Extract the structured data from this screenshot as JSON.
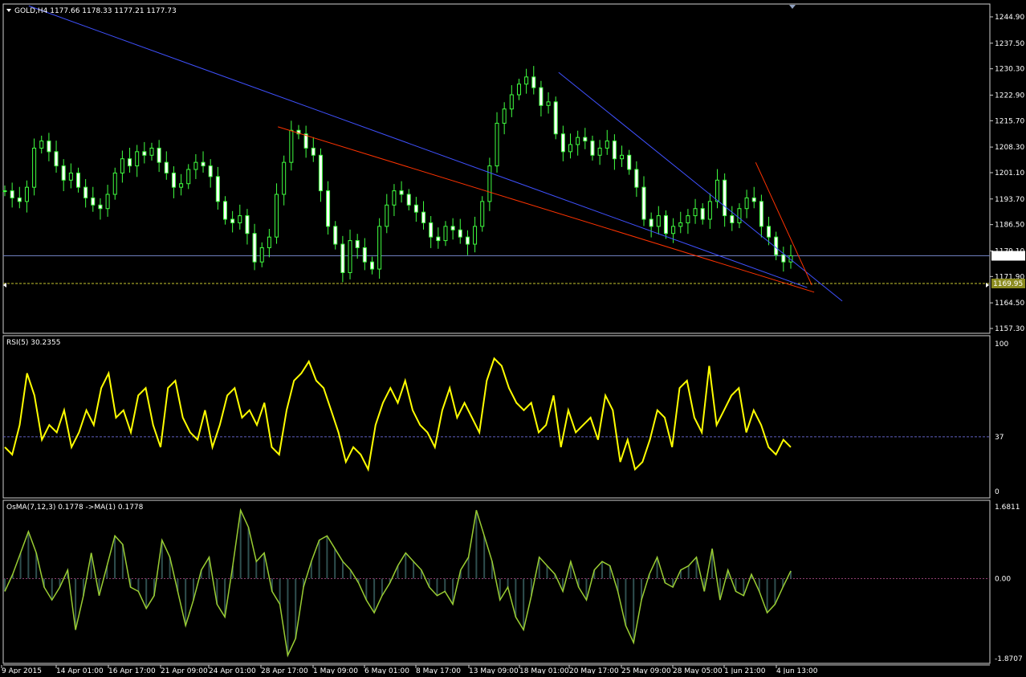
{
  "chart_data": [
    {
      "type": "candlestick",
      "title": "GOLD,H4",
      "ohlc_text": "1177.66 1178.33 1177.21 1177.73",
      "ylim": [
        1157.3,
        1244.9
      ],
      "price_ticks": [
        "1244.90",
        "1237.50",
        "1230.30",
        "1222.90",
        "1215.70",
        "1208.30",
        "1201.10",
        "1193.70",
        "1186.50",
        "1179.10",
        "1171.90",
        "1164.50",
        "1157.30"
      ],
      "current_price": "1177.73",
      "current_price_value": 1177.73,
      "level_line_label": "1169.95",
      "level_line_value": 1169.95,
      "close_values": [
        1196,
        1194,
        1193,
        1197,
        1208,
        1210,
        1207,
        1203,
        1199,
        1201,
        1197,
        1194,
        1192,
        1191,
        1195,
        1201,
        1205,
        1203,
        1207,
        1206,
        1208,
        1204,
        1201,
        1197,
        1198,
        1202,
        1204,
        1203,
        1200,
        1193,
        1188,
        1187,
        1189,
        1184,
        1176,
        1180,
        1183,
        1195,
        1204,
        1213,
        1212,
        1208,
        1206,
        1196,
        1186,
        1181,
        1173,
        1182,
        1180,
        1176,
        1174,
        1186,
        1192,
        1196,
        1195,
        1192,
        1190,
        1187,
        1183,
        1182,
        1186,
        1185,
        1183,
        1181,
        1186,
        1193,
        1203,
        1215,
        1219,
        1223,
        1226,
        1228,
        1225,
        1220,
        1221,
        1212,
        1207,
        1209,
        1211,
        1210,
        1206,
        1208,
        1210,
        1205,
        1206,
        1202,
        1197,
        1188,
        1186,
        1189,
        1184,
        1186,
        1187,
        1189,
        1191,
        1188,
        1193,
        1199,
        1189,
        1187,
        1191,
        1194,
        1193,
        1186,
        1183,
        1178,
        1176,
        1177.73
      ],
      "trendlines": [
        {
          "color": "#3f51ff",
          "from": [
            "11 Apr 2015 06:00",
            1248
          ],
          "to": [
            "5 Jun 2015 17:00",
            1168.8
          ]
        },
        {
          "color": "#3f51ff",
          "from": [
            "19 May 2015 00:00",
            1229.3
          ],
          "to": [
            "8 Jun 2015 05:00",
            1165
          ]
        },
        {
          "color": "#ff3300",
          "from": [
            "29 Apr 2015 00:00",
            1214
          ],
          "to": [
            "6 Jun 2015 05:00",
            1167.5
          ]
        },
        {
          "color": "#ff3300",
          "from": [
            "2 Jun 2015 01:00",
            1204
          ],
          "to": [
            "6 Jun 2015 01:00",
            1169.5
          ]
        }
      ],
      "x_labels": [
        "9 Apr 2015",
        "14 Apr 01:00",
        "16 Apr 17:00",
        "21 Apr 09:00",
        "24 Apr 01:00",
        "28 Apr 17:00",
        "1 May 09:00",
        "6 May 01:00",
        "8 May 17:00",
        "13 May 09:00",
        "18 May 01:00",
        "20 May 17:00",
        "25 May 09:00",
        "28 May 05:00",
        "1 Jun 21:00",
        "4 Jun 13:00"
      ]
    },
    {
      "type": "line",
      "title": "RSI(5) 30.2355",
      "ylim": [
        0,
        100
      ],
      "ticks": [
        "100",
        "37",
        "0"
      ],
      "level": 37,
      "color": "#ffff00",
      "values": [
        30,
        25,
        45,
        80,
        65,
        35,
        45,
        40,
        55,
        30,
        40,
        55,
        45,
        70,
        80,
        50,
        55,
        40,
        65,
        70,
        45,
        30,
        70,
        75,
        50,
        40,
        35,
        55,
        30,
        45,
        65,
        70,
        50,
        55,
        45,
        60,
        30,
        25,
        55,
        75,
        80,
        88,
        75,
        70,
        55,
        40,
        20,
        30,
        25,
        15,
        45,
        60,
        70,
        60,
        75,
        55,
        45,
        40,
        30,
        55,
        70,
        50,
        60,
        50,
        40,
        75,
        90,
        85,
        70,
        60,
        55,
        60,
        40,
        45,
        65,
        30,
        55,
        40,
        45,
        50,
        35,
        65,
        55,
        20,
        35,
        15,
        20,
        35,
        55,
        50,
        30,
        70,
        75,
        50,
        40,
        85,
        45,
        55,
        65,
        70,
        40,
        55,
        45,
        30,
        25,
        35,
        30
      ]
    },
    {
      "type": "bar",
      "title": "OsMA(7,12,3) 0.1778  ->MA(1) 0.1778",
      "ylim": [
        -1.8707,
        1.6811
      ],
      "ticks": [
        "1.6811",
        "0.00",
        "-1.8707"
      ],
      "bar_color": "#2f4f4f",
      "line_color": "#9acd32",
      "values": [
        -0.3,
        0.1,
        0.6,
        1.1,
        0.6,
        -0.2,
        -0.5,
        -0.2,
        0.2,
        -1.2,
        -0.4,
        0.6,
        -0.4,
        0.3,
        1.0,
        0.8,
        -0.2,
        -0.3,
        -0.7,
        -0.4,
        0.9,
        0.5,
        -0.3,
        -1.1,
        -0.5,
        0.2,
        0.5,
        -0.6,
        -0.9,
        0.3,
        1.6,
        1.2,
        0.4,
        0.6,
        -0.3,
        -0.6,
        -1.8,
        -1.4,
        -0.2,
        0.4,
        0.9,
        1.0,
        0.7,
        0.4,
        0.2,
        -0.1,
        -0.5,
        -0.8,
        -0.4,
        -0.1,
        0.3,
        0.6,
        0.4,
        0.2,
        -0.2,
        -0.4,
        -0.3,
        -0.6,
        0.2,
        0.5,
        1.6,
        1.0,
        0.4,
        -0.5,
        -0.2,
        -0.9,
        -1.2,
        -0.4,
        0.5,
        0.3,
        0.1,
        -0.3,
        0.4,
        -0.2,
        -0.5,
        0.2,
        0.4,
        0.3,
        -0.3,
        -1.1,
        -1.5,
        -0.5,
        0.1,
        0.5,
        -0.1,
        -0.2,
        0.2,
        0.3,
        0.5,
        -0.3,
        0.7,
        -0.5,
        0.2,
        -0.3,
        -0.4,
        0.1,
        -0.3,
        -0.8,
        -0.6,
        -0.2,
        0.18
      ]
    }
  ]
}
